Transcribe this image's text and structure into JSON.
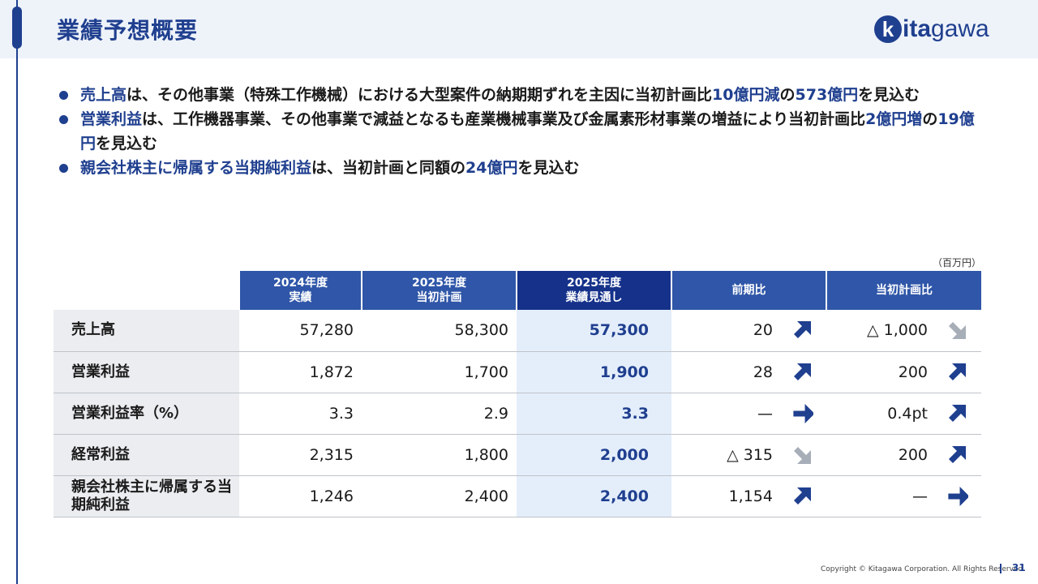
{
  "title": "業績予想概要",
  "logo": {
    "mark": "k",
    "text_bold": "ita",
    "text_regular": "gawa",
    "icon": "kitagawa-logo-icon"
  },
  "bullets": [
    {
      "segments": [
        {
          "text": "売上高",
          "hl": true
        },
        {
          "text": "は、その他事業（特殊工作機械）における大型案件の納期期ずれを主因に当初計画比",
          "hl": false
        },
        {
          "text": "10億円減",
          "hl": true
        },
        {
          "text": "の",
          "hl": false
        },
        {
          "text": "573億円",
          "hl": true
        },
        {
          "text": "を見込む",
          "hl": false
        }
      ]
    },
    {
      "segments": [
        {
          "text": "営業利益",
          "hl": true
        },
        {
          "text": "は、工作機器事業、その他事業で減益となるも産業機械事業及び金属素形材事業の増益により当初計画比",
          "hl": false
        },
        {
          "text": "2億円増",
          "hl": true
        },
        {
          "text": "の",
          "hl": false
        },
        {
          "text": "19億円",
          "hl": true
        },
        {
          "text": "を見込む",
          "hl": false
        }
      ]
    },
    {
      "segments": [
        {
          "text": "親会社株主に帰属する当期純利益",
          "hl": true
        },
        {
          "text": "は、当初計画と同額の",
          "hl": false
        },
        {
          "text": "24億円",
          "hl": true
        },
        {
          "text": "を見込む",
          "hl": false
        }
      ]
    }
  ],
  "table": {
    "unit": "（百万円）",
    "headers": [
      {
        "line1": "2024年度",
        "line2": "実績"
      },
      {
        "line1": "2025年度",
        "line2": "当初計画"
      },
      {
        "line1": "2025年度",
        "line2": "業績見通し"
      },
      {
        "line1": "前期比",
        "line2": ""
      },
      {
        "line1": "当初計画比",
        "line2": ""
      }
    ],
    "rows": [
      {
        "label": "売上高",
        "actual2024": "57,280",
        "plan2025": "58,300",
        "forecast2025": "57,300",
        "yoy": "20",
        "yoy_arrow": "up",
        "vs_plan": "△ 1,000",
        "vs_plan_arrow": "down"
      },
      {
        "label": "営業利益",
        "actual2024": "1,872",
        "plan2025": "1,700",
        "forecast2025": "1,900",
        "yoy": "28",
        "yoy_arrow": "up",
        "vs_plan": "200",
        "vs_plan_arrow": "up"
      },
      {
        "label": "営業利益率（%）",
        "actual2024": "3.3",
        "plan2025": "2.9",
        "forecast2025": "3.3",
        "yoy": "—",
        "yoy_arrow": "flat",
        "vs_plan": "0.4pt",
        "vs_plan_arrow": "up"
      },
      {
        "label": "経常利益",
        "actual2024": "2,315",
        "plan2025": "1,800",
        "forecast2025": "2,000",
        "yoy": "△ 315",
        "yoy_arrow": "down",
        "vs_plan": "200",
        "vs_plan_arrow": "up"
      },
      {
        "label": "親会社株主に帰属する当期純利益",
        "actual2024": "1,246",
        "plan2025": "2,400",
        "forecast2025": "2,400",
        "yoy": "1,154",
        "yoy_arrow": "up",
        "vs_plan": "—",
        "vs_plan_arrow": "flat"
      }
    ]
  },
  "colors": {
    "primary": "#1f3f8f",
    "header_blue": "#2f56a8",
    "header_dark": "#15318a",
    "highlight_col": "#e4eefb",
    "arrow_down_gray": "#a7aeb8"
  },
  "footer": {
    "copyright": "Copyright © Kitagawa Corporation. All Rights Reserved.",
    "page": "31"
  }
}
